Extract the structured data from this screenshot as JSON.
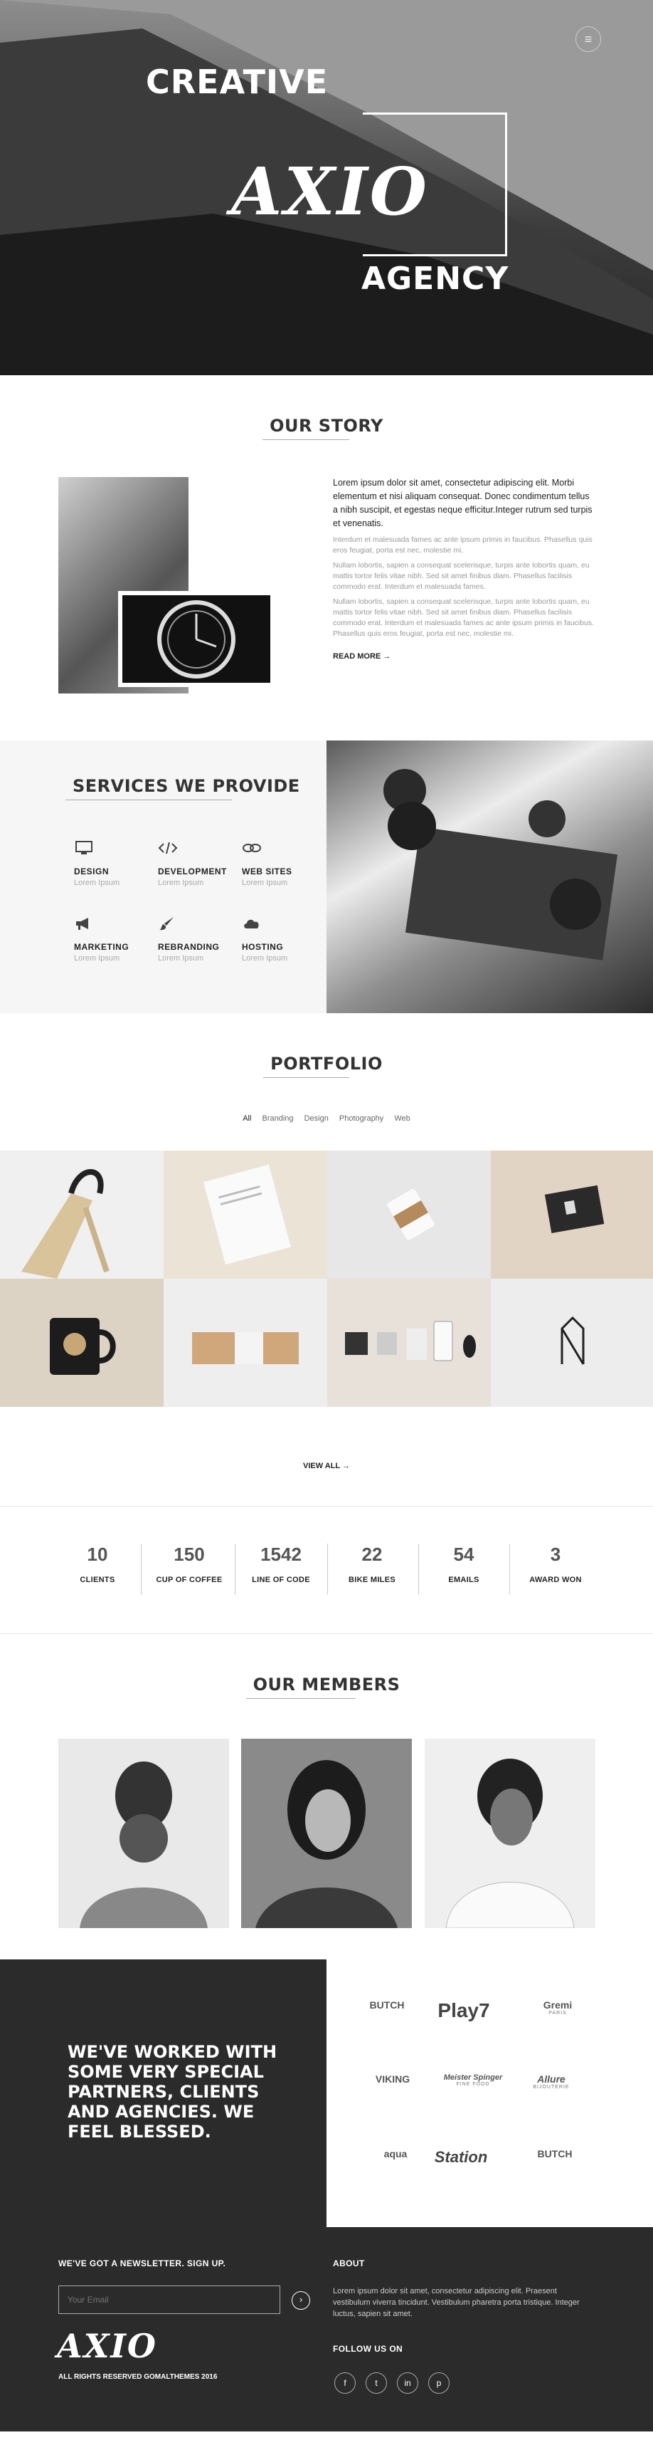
{
  "hero": {
    "creative": "CREATIVE",
    "axio": "AXIO",
    "agency": "AGENCY",
    "menu_icon": "hamburger-icon"
  },
  "story": {
    "title": "OUR STORY",
    "lead": "Lorem ipsum dolor sit amet, consectetur adipiscing elit. Morbi elementum et nisi aliquam consequat. Donec condimentum tellus a nibh suscipit, et egestas neque efficitur.Integer rutrum sed turpis et venenatis.",
    "para1": "Interdum et malesuada fames ac ante ipsum primis in faucibus. Phasellus quis eros feugiat, porta est nec, molestie mi.",
    "para2": "Nullam lobortis, sapien a consequat scelerisque, turpis ante lobortis quam, eu mattis tortor felis vitae nibh. Sed sit amet finibus diam. Phasellus facilisis commodo erat. Interdum et malesuada fames.",
    "para3": "Nullam lobortis, sapien a consequat scelerisque, turpis ante lobortis quam, eu mattis tortor felis vitae nibh. Sed sit amet finibus diam. Phasellus facilisis commodo erat. Interdum et malesuada fames ac ante ipsum primis in faucibus. Phasellus quis eros feugiat, porta est nec, molestie mi.",
    "read_more": "READ MORE →"
  },
  "services": {
    "title": "SERVICES WE PROVIDE",
    "items": [
      {
        "name": "DESIGN",
        "desc": "Lorem Ipsum",
        "icon": "monitor-icon"
      },
      {
        "name": "DEVELOPMENT",
        "desc": "Lorem Ipsum",
        "icon": "code-icon"
      },
      {
        "name": "WEB SITES",
        "desc": "Lorem Ipsum",
        "icon": "link-icon"
      },
      {
        "name": "MARKETING",
        "desc": "Lorem Ipsum",
        "icon": "megaphone-icon"
      },
      {
        "name": "REBRANDING",
        "desc": "Lorem Ipsum",
        "icon": "brush-icon"
      },
      {
        "name": "HOSTING",
        "desc": "Lorem Ipsum",
        "icon": "cloud-icon"
      }
    ]
  },
  "portfolio": {
    "title": "PORTFOLIO",
    "filters": [
      "All",
      "Branding",
      "Design",
      "Photography",
      "Web"
    ],
    "view_all": "VIEW ALL →"
  },
  "stats": [
    {
      "num": "10",
      "label": "CLIENTS"
    },
    {
      "num": "150",
      "label": "CUP OF COFFEE"
    },
    {
      "num": "1542",
      "label": "LINE OF CODE"
    },
    {
      "num": "22",
      "label": "BIKE MILES"
    },
    {
      "num": "54",
      "label": "EMAILS"
    },
    {
      "num": "3",
      "label": "AWARD WON"
    }
  ],
  "members": {
    "title": "OUR MEMBERS"
  },
  "partners": {
    "text": "WE'VE WORKED WITH SOME VERY SPECIAL PARTNERS, CLIENTS AND AGENCIES. WE FEEL BLESSED.",
    "logos": [
      {
        "name": "BUTCH",
        "sub": ""
      },
      {
        "name": "Play7",
        "sub": ""
      },
      {
        "name": "Gremi",
        "sub": "PARIS"
      },
      {
        "name": "VIKING",
        "sub": ""
      },
      {
        "name": "Meister Spinger",
        "sub": "FINE FOOD"
      },
      {
        "name": "Allure",
        "sub": "BIJOUTERIE"
      },
      {
        "name": "aqua",
        "sub": ""
      },
      {
        "name": "Station",
        "sub": ""
      },
      {
        "name": "BUTCH",
        "sub": ""
      }
    ]
  },
  "footer": {
    "newsletter": "WE'VE GOT A NEWSLETTER. SIGN UP.",
    "email_placeholder": "Your Email",
    "logo": "AXIO",
    "rights": "ALL RIGHTS RESERVED GOMALTHEMES 2016",
    "about_title": "ABOUT",
    "about_text": "Lorem ipsum dolor sit amet, consectetur adipiscing elit. Praesent vestibulum viverra tincidunt. Vestibulum pharetra porta tristique. Integer luctus, sapien sit amet.",
    "follow": "FOLLOW US ON",
    "social": [
      {
        "glyph": "f",
        "icon": "facebook-icon"
      },
      {
        "glyph": "t",
        "icon": "twitter-icon"
      },
      {
        "glyph": "in",
        "icon": "linkedin-icon"
      },
      {
        "glyph": "p",
        "icon": "pinterest-icon"
      }
    ]
  }
}
